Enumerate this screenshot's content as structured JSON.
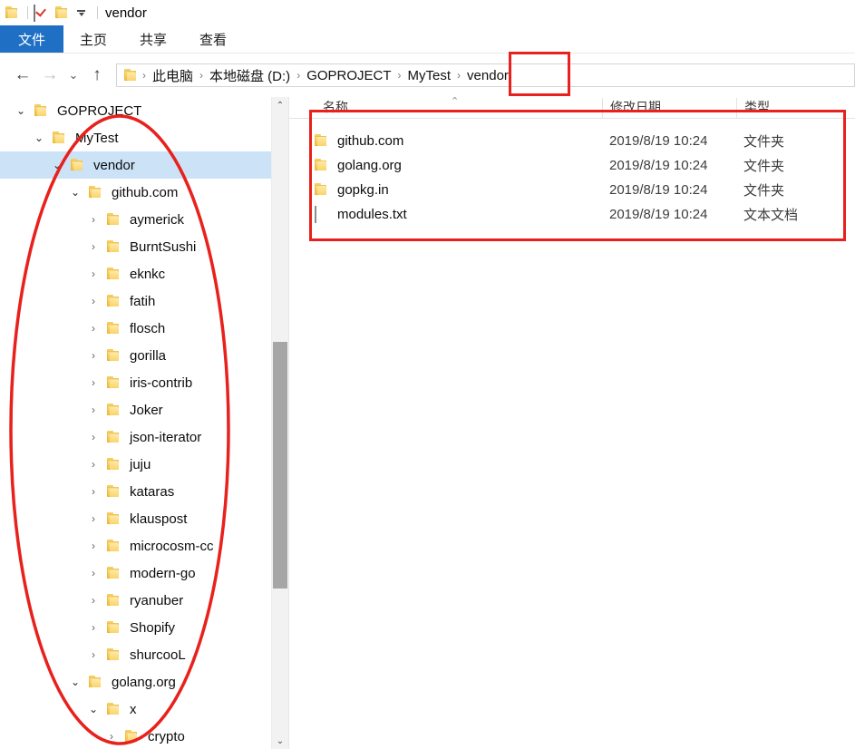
{
  "window": {
    "title": "vendor",
    "quick_access": [
      {
        "name": "folder-icon",
        "label": "folder"
      },
      {
        "name": "properties-icon",
        "label": "properties"
      },
      {
        "name": "new-folder-icon",
        "label": "new folder"
      },
      {
        "name": "customize-caret-icon",
        "label": "customize quick access toolbar"
      }
    ]
  },
  "ribbon": {
    "tabs": [
      {
        "label": "文件",
        "active": true
      },
      {
        "label": "主页",
        "active": false
      },
      {
        "label": "共享",
        "active": false
      },
      {
        "label": "查看",
        "active": false
      }
    ]
  },
  "address_bar": {
    "back": "←",
    "forward": "→",
    "recent": "⌄",
    "up": "↑",
    "breadcrumbs": [
      "此电脑",
      "本地磁盘 (D:)",
      "GOPROJECT",
      "MyTest",
      "vendor"
    ],
    "separator": "›"
  },
  "tree": {
    "items": [
      {
        "label": "GOPROJECT",
        "level": 0,
        "state": "expanded",
        "icon": "folder-icon",
        "selected": false
      },
      {
        "label": "MyTest",
        "level": 1,
        "state": "expanded",
        "icon": "folder-icon",
        "selected": false
      },
      {
        "label": "vendor",
        "level": 2,
        "state": "expanded",
        "icon": "folder-icon",
        "selected": true
      },
      {
        "label": "github.com",
        "level": 3,
        "state": "expanded",
        "icon": "folder-icon",
        "selected": false
      },
      {
        "label": "aymerick",
        "level": 4,
        "state": "collapsed",
        "icon": "folder-icon",
        "selected": false
      },
      {
        "label": "BurntSushi",
        "level": 4,
        "state": "collapsed",
        "icon": "folder-icon",
        "selected": false
      },
      {
        "label": "eknkc",
        "level": 4,
        "state": "collapsed",
        "icon": "folder-icon",
        "selected": false
      },
      {
        "label": "fatih",
        "level": 4,
        "state": "collapsed",
        "icon": "folder-icon",
        "selected": false
      },
      {
        "label": "flosch",
        "level": 4,
        "state": "collapsed",
        "icon": "folder-icon",
        "selected": false
      },
      {
        "label": "gorilla",
        "level": 4,
        "state": "collapsed",
        "icon": "folder-icon",
        "selected": false
      },
      {
        "label": "iris-contrib",
        "level": 4,
        "state": "collapsed",
        "icon": "folder-icon",
        "selected": false
      },
      {
        "label": "Joker",
        "level": 4,
        "state": "collapsed",
        "icon": "folder-icon",
        "selected": false
      },
      {
        "label": "json-iterator",
        "level": 4,
        "state": "collapsed",
        "icon": "folder-icon",
        "selected": false
      },
      {
        "label": "juju",
        "level": 4,
        "state": "collapsed",
        "icon": "folder-icon",
        "selected": false
      },
      {
        "label": "kataras",
        "level": 4,
        "state": "collapsed",
        "icon": "folder-icon",
        "selected": false
      },
      {
        "label": "klauspost",
        "level": 4,
        "state": "collapsed",
        "icon": "folder-icon",
        "selected": false
      },
      {
        "label": "microcosm-cc",
        "level": 4,
        "state": "collapsed",
        "icon": "folder-icon",
        "selected": false
      },
      {
        "label": "modern-go",
        "level": 4,
        "state": "collapsed",
        "icon": "folder-icon",
        "selected": false
      },
      {
        "label": "ryanuber",
        "level": 4,
        "state": "collapsed",
        "icon": "folder-icon",
        "selected": false
      },
      {
        "label": "Shopify",
        "level": 4,
        "state": "collapsed",
        "icon": "folder-icon",
        "selected": false
      },
      {
        "label": "shurcooL",
        "level": 4,
        "state": "collapsed",
        "icon": "folder-icon",
        "selected": false
      },
      {
        "label": "golang.org",
        "level": 3,
        "state": "expanded",
        "icon": "folder-icon",
        "selected": false
      },
      {
        "label": "x",
        "level": 4,
        "state": "expanded",
        "icon": "folder-icon",
        "selected": false
      },
      {
        "label": "crypto",
        "level": 5,
        "state": "collapsed",
        "icon": "folder-icon",
        "selected": false
      }
    ],
    "chevron_expanded": "⌄",
    "chevron_collapsed": "›",
    "scrollbar": {
      "up_arrow": "⌃",
      "down_arrow": "⌄"
    }
  },
  "file_list": {
    "sort_indicator": "⌃",
    "columns": [
      {
        "label": "名称"
      },
      {
        "label": "修改日期"
      },
      {
        "label": "类型"
      }
    ],
    "rows": [
      {
        "name": "github.com",
        "date": "2019/8/19 10:24",
        "type": "文件夹",
        "icon": "folder-icon"
      },
      {
        "name": "golang.org",
        "date": "2019/8/19 10:24",
        "type": "文件夹",
        "icon": "folder-icon"
      },
      {
        "name": "gopkg.in",
        "date": "2019/8/19 10:24",
        "type": "文件夹",
        "icon": "folder-icon"
      },
      {
        "name": "modules.txt",
        "date": "2019/8/19 10:24",
        "type": "文本文档",
        "icon": "text-file-icon"
      }
    ]
  },
  "annotations": {
    "color": "#e8211c",
    "shapes": [
      {
        "name": "breadcrumb-highlight-rect",
        "target": "vendor"
      },
      {
        "name": "file-list-highlight-rect",
        "target": "file list rows"
      },
      {
        "name": "tree-highlight-ellipse",
        "target": "vendor subtree"
      }
    ]
  }
}
